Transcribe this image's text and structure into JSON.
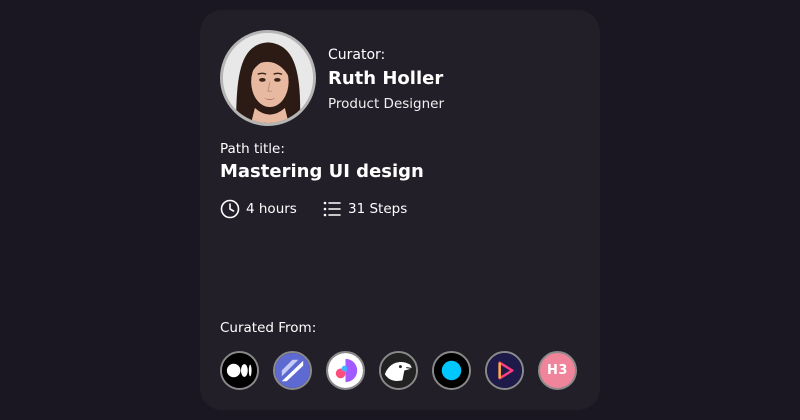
{
  "curator": {
    "label": "Curator:",
    "name": "Ruth Holler",
    "role": "Product Designer",
    "avatar_icon": "curator-portrait"
  },
  "path": {
    "label": "Path title:",
    "title": "Mastering UI design",
    "duration": "4 hours",
    "duration_icon": "clock-icon",
    "steps": "31 Steps",
    "steps_icon": "list-icon"
  },
  "curated_from": {
    "label": "Curated From:",
    "sources": [
      {
        "icon": "medium-logo-icon",
        "color": "#000000"
      },
      {
        "icon": "linear-logo-icon",
        "color": "#5e6ad2"
      },
      {
        "icon": "figma-style-logo-icon",
        "color": "#a259ff"
      },
      {
        "icon": "dog-logo-icon",
        "color": "#222222"
      },
      {
        "icon": "cyan-dot-logo-icon",
        "color": "#00c8ff"
      },
      {
        "icon": "play-logo-icon",
        "color": "#1e1a4a"
      },
      {
        "icon": "h3-logo-icon",
        "text": "H3",
        "color": "#f0849a"
      }
    ]
  },
  "colors": {
    "page_background": "#1a1722",
    "card_background": "#221f29",
    "text": "#ffffff"
  }
}
